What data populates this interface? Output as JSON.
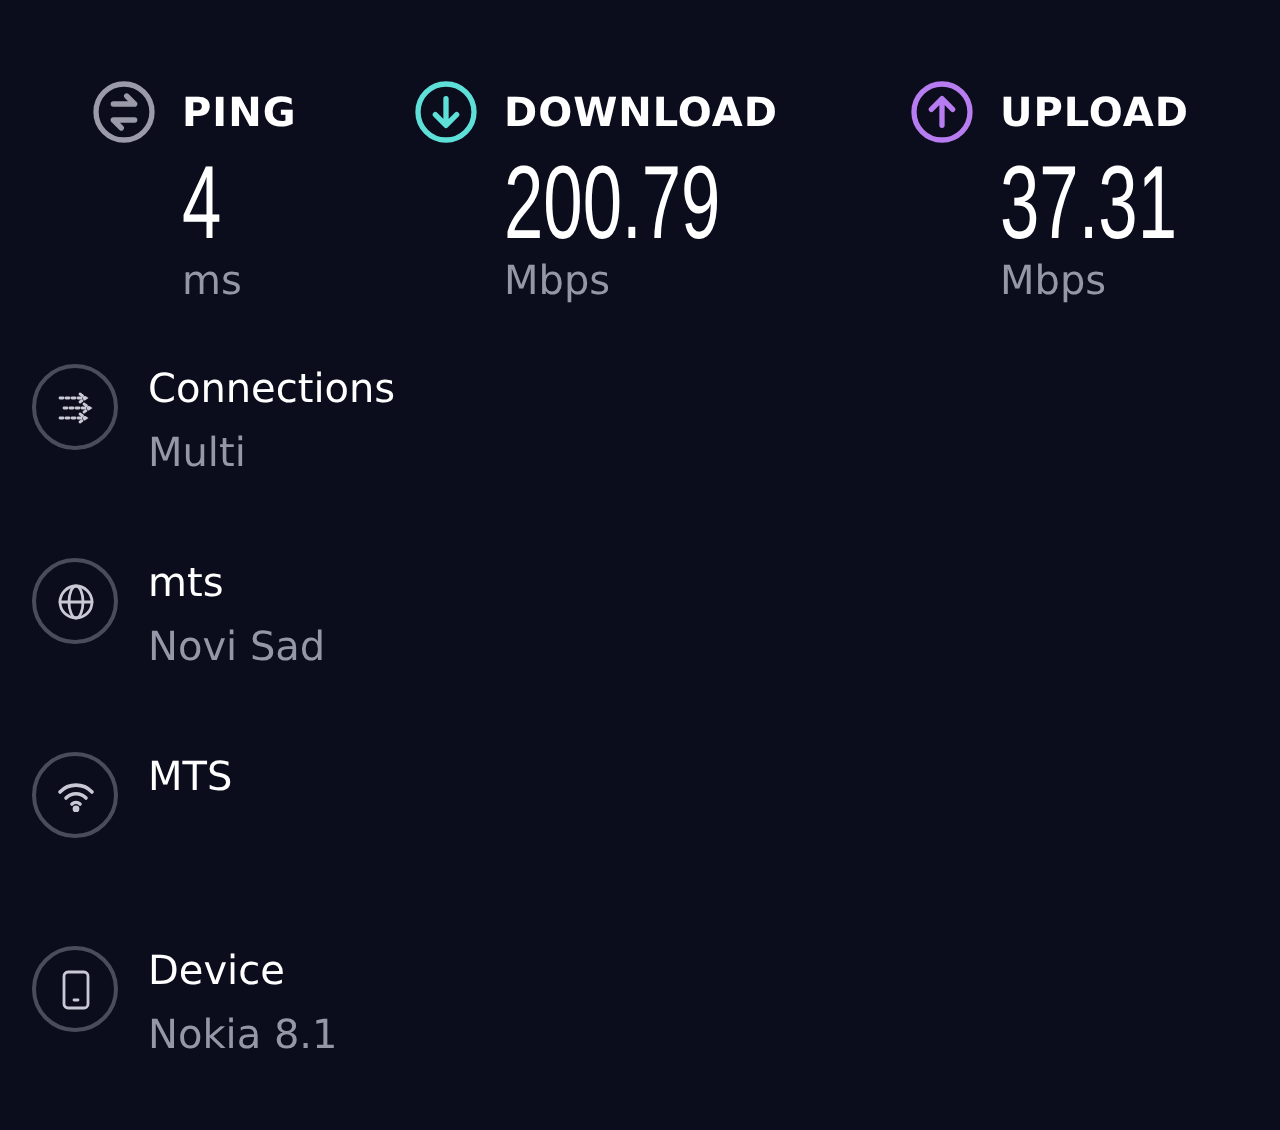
{
  "metrics": [
    {
      "kind": "ping",
      "label": "PING",
      "value": "4",
      "unit": "ms",
      "color": "#9a9aa8"
    },
    {
      "kind": "download",
      "label": "DOWNLOAD",
      "value": "200.79",
      "unit": "Mbps",
      "color": "#5ee0d8"
    },
    {
      "kind": "upload",
      "label": "UPLOAD",
      "value": "37.31",
      "unit": "Mbps",
      "color": "#b77cf0"
    }
  ],
  "details": [
    {
      "kind": "connections",
      "title": "Connections",
      "subtitle": "Multi"
    },
    {
      "kind": "globe",
      "title": "mts",
      "subtitle": "Novi Sad"
    },
    {
      "kind": "wifi",
      "title": "MTS"
    },
    {
      "kind": "device",
      "title": "Device",
      "subtitle": "Nokia 8.1"
    }
  ]
}
